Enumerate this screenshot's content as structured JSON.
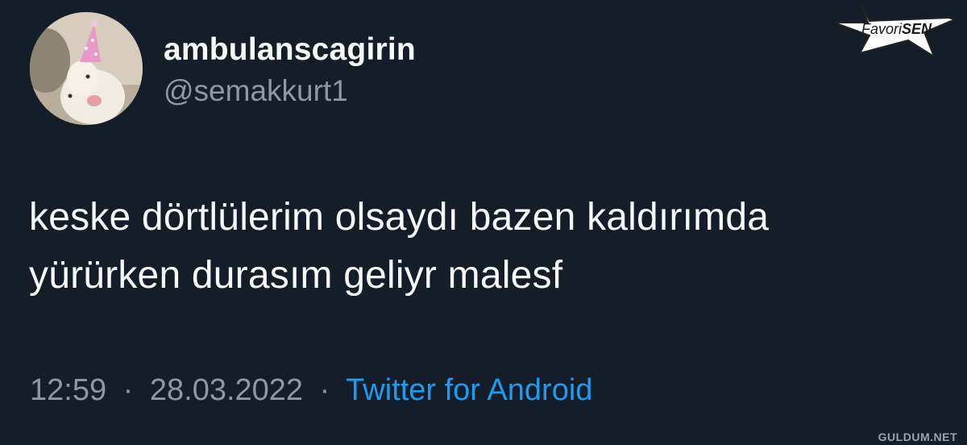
{
  "tweet": {
    "author": {
      "display_name": "ambulanscagirin",
      "handle": "@semakkurt1",
      "avatar": "dog-with-party-hat-avatar"
    },
    "text_lines": [
      "keske dörtlülerim olsaydı bazen kaldırımda",
      "yürürken durasım geliyr malesf"
    ],
    "meta": {
      "time": "12:59",
      "date": "28.03.2022",
      "separator": "·",
      "source": "Twitter for Android"
    }
  },
  "watermark": {
    "brand_prefix": "Favori",
    "brand_suffix": "SEN",
    "footer": "GULDUM.NET"
  },
  "colors": {
    "background": "#151d29",
    "text": "#f7f9f9",
    "muted": "#8b98a5",
    "link": "#1d9bf0"
  }
}
